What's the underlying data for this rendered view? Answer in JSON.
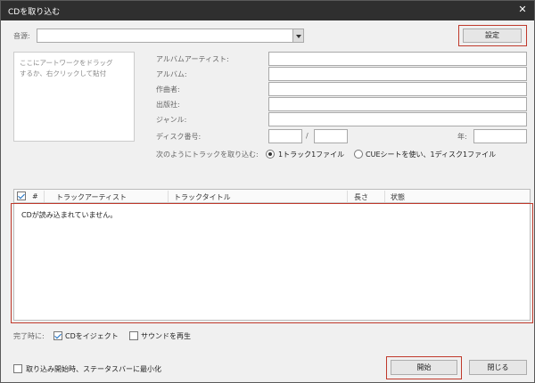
{
  "window": {
    "title": "CDを取り込む",
    "close_glyph": "✕"
  },
  "source": {
    "label": "音源:",
    "value": ""
  },
  "settings_button": "設定",
  "artwork": {
    "placeholder": "ここにアートワークをドラッグするか、右クリックして貼付"
  },
  "fields": {
    "album_artist": {
      "label": "アルバムアーティスト:",
      "value": ""
    },
    "album": {
      "label": "アルバム:",
      "value": ""
    },
    "composer": {
      "label": "作曲者:",
      "value": ""
    },
    "publisher": {
      "label": "出版社:",
      "value": ""
    },
    "genre": {
      "label": "ジャンル:",
      "value": ""
    },
    "disc_number": {
      "label": "ディスク番号:",
      "value": "",
      "separator": "/",
      "total": ""
    },
    "year": {
      "label": "年:",
      "value": ""
    }
  },
  "rip_mode": {
    "label": "次のようにトラックを取り込む:",
    "options": [
      {
        "label": "1トラック1ファイル",
        "selected": true
      },
      {
        "label": "CUEシートを使い、1ディスク1ファイル",
        "selected": false
      }
    ]
  },
  "track_table": {
    "select_all_checked": true,
    "columns": [
      "#",
      "トラックアーティスト",
      "トラックタイトル",
      "長さ",
      "状態"
    ],
    "rows": [],
    "empty_message": "CDが読み込まれていません。"
  },
  "on_complete": {
    "label": "完了時に:",
    "eject": {
      "label": "CDをイジェクト",
      "checked": true
    },
    "play_sound": {
      "label": "サウンドを再生",
      "checked": false
    }
  },
  "minimize_on_start": {
    "label": "取り込み開始時、ステータスバーに最小化",
    "checked": false
  },
  "buttons": {
    "start": "開始",
    "close": "閉じる"
  },
  "colors": {
    "highlight": "#c0392b",
    "titlebar": "#2f2f2f",
    "accent": "#1a6fc4"
  }
}
